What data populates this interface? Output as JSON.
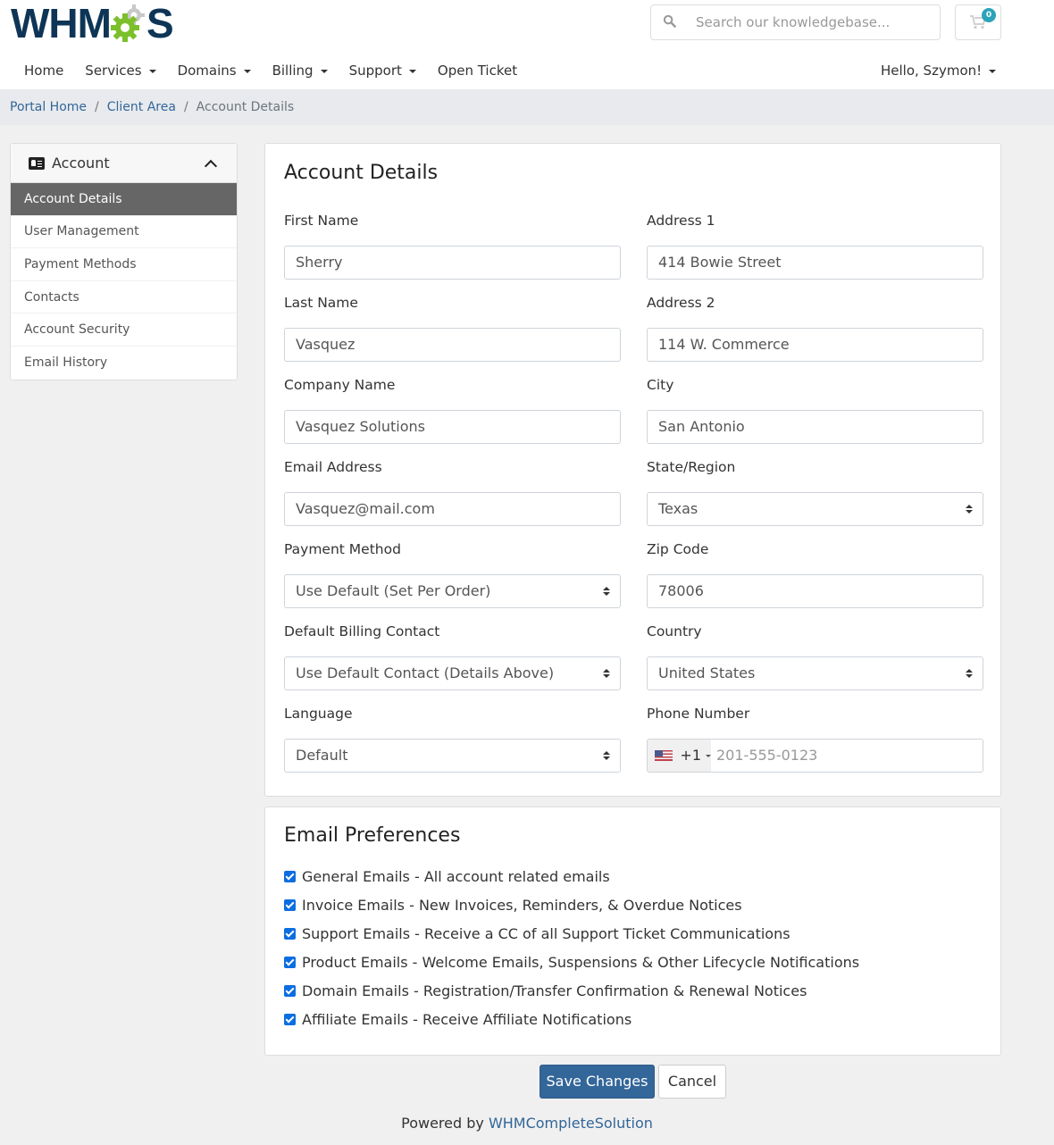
{
  "brand": {
    "logo_text_left": "WHM",
    "logo_text_right": "S",
    "accent": "#336699",
    "gear_green": "#7bc02a",
    "gear_grey": "#c8c8c8"
  },
  "header": {
    "search_placeholder": "Search our knowledgebase...",
    "cart_count": "0",
    "nav": [
      {
        "label": "Home",
        "dropdown": false
      },
      {
        "label": "Services",
        "dropdown": true
      },
      {
        "label": "Domains",
        "dropdown": true
      },
      {
        "label": "Billing",
        "dropdown": true
      },
      {
        "label": "Support",
        "dropdown": true
      },
      {
        "label": "Open Ticket",
        "dropdown": false
      }
    ],
    "user_menu": "Hello, Szymon!"
  },
  "breadcrumb": [
    {
      "label": "Portal Home"
    },
    {
      "label": "Client Area"
    },
    {
      "label": "Account Details"
    }
  ],
  "sidebar": {
    "title": "Account",
    "items": [
      {
        "label": "Account Details",
        "active": true
      },
      {
        "label": "User Management"
      },
      {
        "label": "Payment Methods"
      },
      {
        "label": "Contacts"
      },
      {
        "label": "Account Security"
      },
      {
        "label": "Email History"
      }
    ]
  },
  "account_details": {
    "title": "Account Details",
    "first_name": {
      "label": "First Name",
      "value": "Sherry"
    },
    "last_name": {
      "label": "Last Name",
      "value": "Vasquez"
    },
    "company_name": {
      "label": "Company Name",
      "value": "Vasquez Solutions"
    },
    "email": {
      "label": "Email Address",
      "value": "Vasquez@mail.com"
    },
    "payment_method": {
      "label": "Payment Method",
      "value": "Use Default (Set Per Order)"
    },
    "billing_contact": {
      "label": "Default Billing Contact",
      "value": "Use Default Contact (Details Above)"
    },
    "language": {
      "label": "Language",
      "value": "Default"
    },
    "address1": {
      "label": "Address 1",
      "value": "414 Bowie Street"
    },
    "address2": {
      "label": "Address 2",
      "value": "114 W. Commerce"
    },
    "city": {
      "label": "City",
      "value": "San Antonio"
    },
    "state": {
      "label": "State/Region",
      "value": "Texas"
    },
    "zip": {
      "label": "Zip Code",
      "value": "78006"
    },
    "country": {
      "label": "Country",
      "value": "United States"
    },
    "phone": {
      "label": "Phone Number",
      "country_code": "+1",
      "placeholder": "201-555-0123"
    }
  },
  "email_preferences": {
    "title": "Email Preferences",
    "items": [
      {
        "label": "General Emails - All account related emails",
        "checked": true
      },
      {
        "label": "Invoice Emails - New Invoices, Reminders, & Overdue Notices",
        "checked": true
      },
      {
        "label": "Support Emails - Receive a CC of all Support Ticket Communications",
        "checked": true
      },
      {
        "label": "Product Emails - Welcome Emails, Suspensions & Other Lifecycle Notifications",
        "checked": true
      },
      {
        "label": "Domain Emails - Registration/Transfer Confirmation & Renewal Notices",
        "checked": true
      },
      {
        "label": "Affiliate Emails - Receive Affiliate Notifications",
        "checked": true
      }
    ]
  },
  "actions": {
    "save": "Save Changes",
    "cancel": "Cancel"
  },
  "footer": {
    "prefix": "Powered by",
    "link": "WHMCompleteSolution"
  }
}
